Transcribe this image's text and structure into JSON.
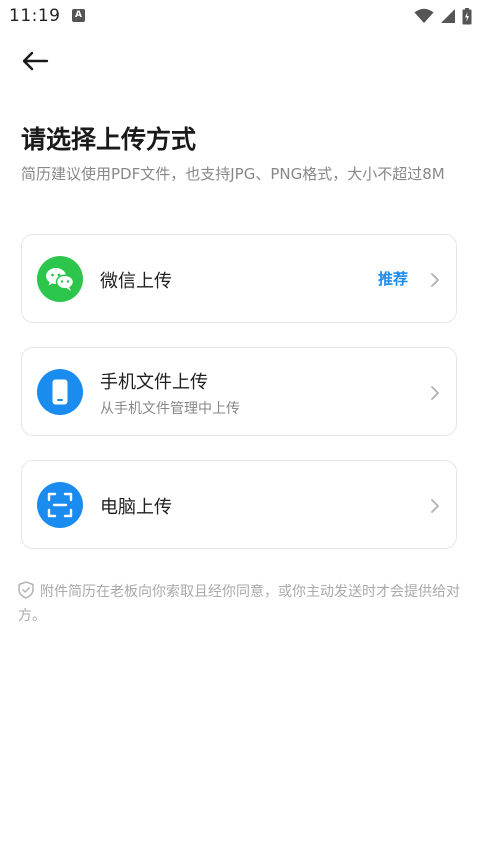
{
  "status_bar": {
    "time": "11:19",
    "notification_letter": "A"
  },
  "header": {
    "back_icon": "arrow-left-icon"
  },
  "page": {
    "title": "请选择上传方式",
    "subtitle": "简历建议使用PDF文件，也支持JPG、PNG格式，大小不超过8M"
  },
  "options": [
    {
      "label": "微信上传",
      "badge": "推荐",
      "icon": "wechat-icon",
      "color": "#2dc64c"
    },
    {
      "label": "手机文件上传",
      "description": "从手机文件管理中上传",
      "icon": "phone-icon",
      "color": "#1a8cf0"
    },
    {
      "label": "电脑上传",
      "icon": "scan-icon",
      "color": "#1a8cf0"
    }
  ],
  "notice": {
    "text": "附件简历在老板向你索取且经你同意，或你主动发送时才会提供给对方。",
    "icon": "shield-check-icon"
  },
  "colors": {
    "accent": "#1a8cf0",
    "wechat": "#2dc64c"
  }
}
